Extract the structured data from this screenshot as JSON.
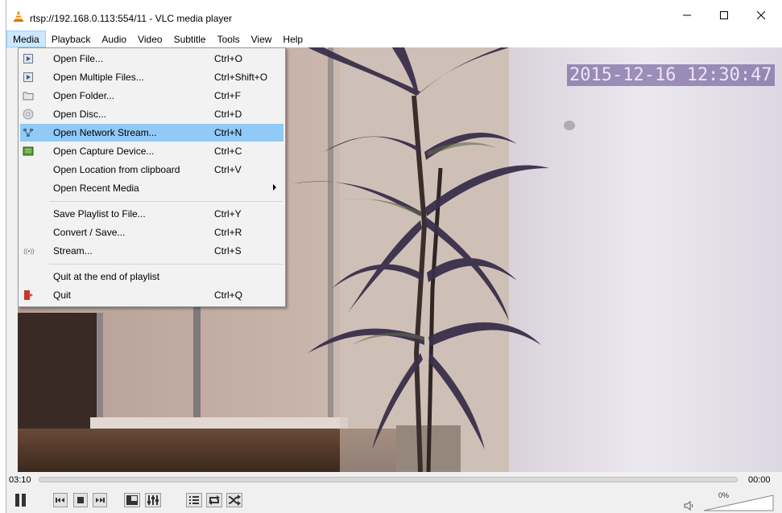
{
  "window": {
    "title": "rtsp://192.168.0.113:554/11 - VLC media player",
    "app_icon": "vlc-cone-icon",
    "controls": [
      "minimize-icon",
      "maximize-icon",
      "close-icon"
    ]
  },
  "menubar": {
    "items": [
      {
        "label": "Media",
        "active": true
      },
      {
        "label": "Playback"
      },
      {
        "label": "Audio"
      },
      {
        "label": "Video"
      },
      {
        "label": "Subtitle"
      },
      {
        "label": "Tools"
      },
      {
        "label": "View"
      },
      {
        "label": "Help"
      }
    ]
  },
  "media_menu": {
    "items": [
      {
        "label": "Open File...",
        "shortcut": "Ctrl+O",
        "icon": "open-file-icon"
      },
      {
        "label": "Open Multiple Files...",
        "shortcut": "Ctrl+Shift+O",
        "icon": "open-multiple-files-icon"
      },
      {
        "label": "Open Folder...",
        "shortcut": "Ctrl+F",
        "icon": "folder-icon"
      },
      {
        "label": "Open Disc...",
        "shortcut": "Ctrl+D",
        "icon": "disc-icon"
      },
      {
        "label": "Open Network Stream...",
        "shortcut": "Ctrl+N",
        "icon": "network-icon",
        "highlighted": true
      },
      {
        "label": "Open Capture Device...",
        "shortcut": "Ctrl+C",
        "icon": "capture-device-icon"
      },
      {
        "label": "Open Location from clipboard",
        "shortcut": "Ctrl+V"
      },
      {
        "label": "Open Recent Media",
        "submenu": true
      },
      {
        "label": "Save Playlist to File...",
        "shortcut": "Ctrl+Y"
      },
      {
        "label": "Convert / Save...",
        "shortcut": "Ctrl+R"
      },
      {
        "label": "Stream...",
        "shortcut": "Ctrl+S",
        "icon": "stream-icon",
        "icon_text": "((•))"
      },
      {
        "label": "Quit at the end of playlist"
      },
      {
        "label": "Quit",
        "shortcut": "Ctrl+Q",
        "icon": "quit-icon"
      }
    ]
  },
  "video": {
    "osd_timestamp": "2015-12-16 12:30:47"
  },
  "playback": {
    "elapsed": "03:10",
    "remaining": "00:00",
    "progress": 0
  },
  "controls": {
    "buttons": [
      "pause-icon",
      "previous-icon",
      "stop-icon",
      "next-icon",
      "fullscreen-icon",
      "extended-settings-icon",
      "playlist-icon",
      "loop-icon",
      "shuffle-icon"
    ],
    "volume_percent": "0%",
    "volume_level": 0
  },
  "colors": {
    "menu_highlight": "#91c9f7",
    "menubar_active": "#cce8ff",
    "vlc_orange": "#f08a00"
  }
}
